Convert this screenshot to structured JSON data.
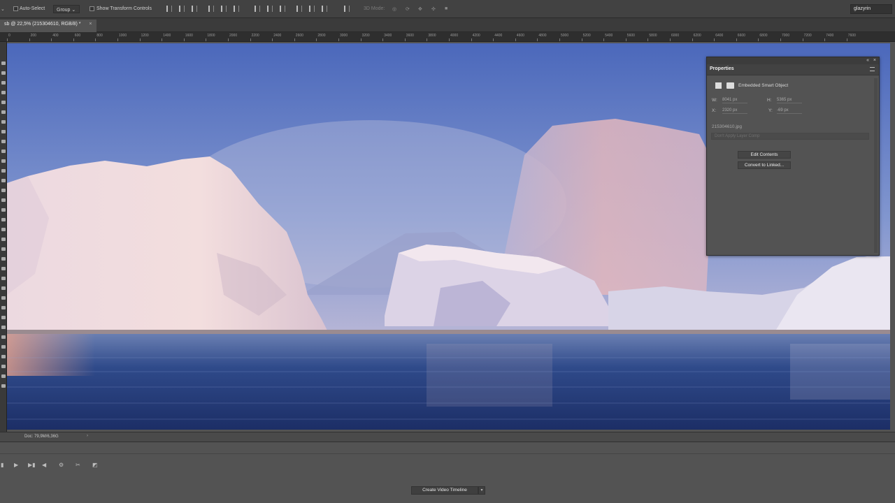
{
  "options_bar": {
    "auto_select_label": "Auto-Select",
    "group_select": "Group",
    "show_transform_label": "Show Transform Controls",
    "mode_3d_label": "3D Mode:",
    "workspace": "glazyrin"
  },
  "document_tab": {
    "title": "sb @ 22,5% (215304610, RGB/8) *",
    "close": "×"
  },
  "ruler": {
    "labels": [
      "0",
      "200",
      "400",
      "600",
      "800",
      "1000",
      "1200",
      "1400",
      "1600",
      "1800",
      "2000",
      "2200",
      "2400",
      "2600",
      "2800",
      "3000",
      "3200",
      "3400",
      "3600",
      "3800",
      "4000",
      "4200",
      "4400",
      "4600",
      "4800",
      "5000",
      "5200",
      "5400",
      "5600",
      "5800",
      "6000",
      "6200",
      "6400",
      "6600",
      "6800",
      "7000",
      "7200",
      "7400",
      "7600"
    ]
  },
  "properties_panel": {
    "tab_label": "Properties",
    "object_type": "Embedded Smart Object",
    "w_label": "W:",
    "w_value": "8041 px",
    "h_label": "H:",
    "h_value": "5365 px",
    "x_label": "X:",
    "x_value": "2320 px",
    "y_label": "Y:",
    "y_value": "-69 px",
    "filename": "215304610.jpg",
    "layer_comp_placeholder": "Don't Apply Layer Comp",
    "edit_contents_label": "Edit Contents",
    "convert_linked_label": "Convert to Linked..."
  },
  "status_bar": {
    "doc_info": "Doc: 79,9M/6,36G",
    "arrow": "›"
  },
  "timeline": {
    "create_button_label": "Create Video Timeline",
    "dropdown_arrow": "▾"
  },
  "icons": {
    "play": "play-icon",
    "step_back": "step-back-icon",
    "step_forward": "step-forward-icon",
    "audio": "audio-icon",
    "cut": "scissors-icon"
  },
  "colors": {
    "ui_dark": "#424242",
    "ui_mid": "#535353",
    "sky_top": "#4f6fc0",
    "water": "#2a3f7a"
  }
}
